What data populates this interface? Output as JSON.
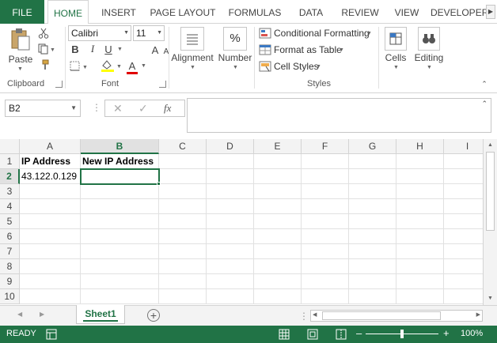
{
  "ribbon_tabs": [
    "FILE",
    "HOME",
    "INSERT",
    "PAGE LAYOUT",
    "FORMULAS",
    "DATA",
    "REVIEW",
    "VIEW",
    "DEVELOPER"
  ],
  "clipboard": {
    "paste_label": "Paste",
    "group_label": "Clipboard"
  },
  "font": {
    "name": "Calibri",
    "size": "11",
    "group_label": "Font",
    "bold": "B",
    "italic": "I",
    "underline": "U",
    "grow": "A",
    "shrink": "A",
    "font_color": "A"
  },
  "alignment": {
    "label": "Alignment"
  },
  "number": {
    "label": "Number",
    "glyph": "%"
  },
  "styles": {
    "conditional": "Conditional Formatting",
    "format_table": "Format as Table",
    "cell_styles": "Cell Styles",
    "group_label": "Styles"
  },
  "cells": {
    "label": "Cells"
  },
  "editing": {
    "label": "Editing"
  },
  "formula_bar": {
    "name_box": "B2",
    "fx": "fx",
    "formula": ""
  },
  "grid": {
    "columns": [
      "A",
      "B",
      "C",
      "D",
      "E",
      "F",
      "G",
      "H",
      "I"
    ],
    "rows": [
      "1",
      "2",
      "3",
      "4",
      "5",
      "6",
      "7",
      "8",
      "9",
      "10"
    ],
    "selected_column": "B",
    "selected_row": "2",
    "a1": "IP Address",
    "b1": "New IP Address",
    "a2": "43.122.0.129",
    "b2": ""
  },
  "sheets": {
    "active": "Sheet1"
  },
  "status": {
    "ready": "READY",
    "zoom": "100%"
  },
  "colors": {
    "accent": "#217346"
  }
}
